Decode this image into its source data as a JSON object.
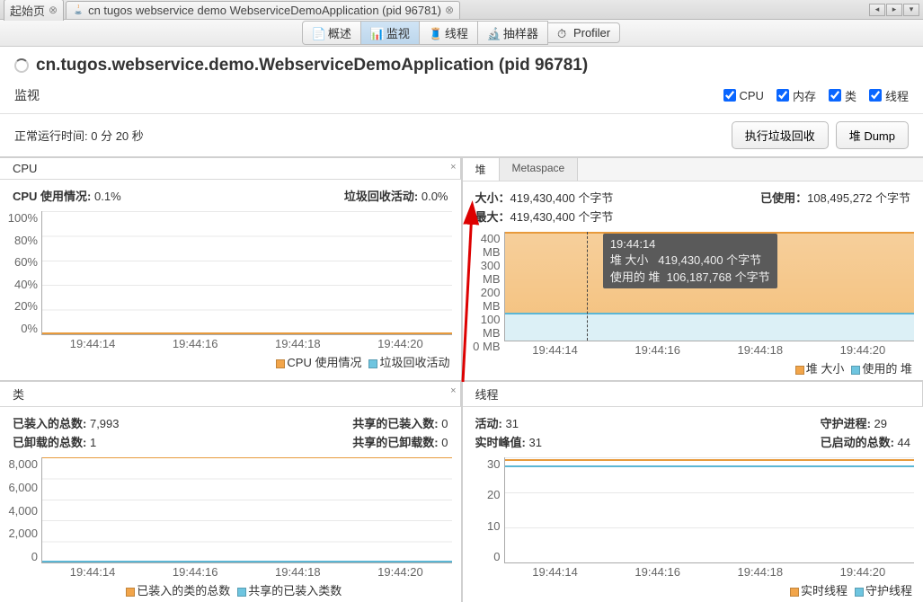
{
  "tabs": {
    "start": "起始页",
    "app": "cn tugos webservice demo WebserviceDemoApplication (pid 96781)"
  },
  "toolbar": {
    "overview": "概述",
    "monitor": "监视",
    "threads": "线程",
    "sampler": "抽样器",
    "profiler": "Profiler"
  },
  "title": "cn.tugos.webservice.demo.WebserviceDemoApplication (pid 96781)",
  "section": "监视",
  "checks": {
    "cpu": "CPU",
    "mem": "内存",
    "class": "类",
    "thread": "线程"
  },
  "uptime": {
    "label": "正常运行时间:",
    "value": "0 分 20 秒"
  },
  "buttons": {
    "gc": "执行垃圾回收",
    "dump": "堆 Dump"
  },
  "cpu": {
    "tab": "CPU",
    "usage_lbl": "CPU 使用情况:",
    "usage_val": "0.1%",
    "gc_lbl": "垃圾回收活动:",
    "gc_val": "0.0%",
    "legend1": "CPU 使用情况",
    "legend2": "垃圾回收活动",
    "yticks": [
      "100%",
      "80%",
      "60%",
      "40%",
      "20%",
      "0%"
    ],
    "xticks": [
      "19:44:14",
      "19:44:16",
      "19:44:18",
      "19:44:20"
    ]
  },
  "heap": {
    "tab1": "堆",
    "tab2": "Metaspace",
    "size_lbl": "大小：",
    "size_val": "419,430,400 个字节",
    "max_lbl": "最大：",
    "max_val": "419,430,400 个字节",
    "used_lbl": "已使用：",
    "used_val": "108,495,272 个字节",
    "legend1": "堆 大小",
    "legend2": "使用的 堆",
    "yticks": [
      "400 MB",
      "300 MB",
      "200 MB",
      "100 MB",
      "0 MB"
    ],
    "xticks": [
      "19:44:14",
      "19:44:16",
      "19:44:18",
      "19:44:20"
    ],
    "tooltip": {
      "time": "19:44:14",
      "l1": "堆 大小",
      "v1": "419,430,400 个字节",
      "l2": "使用的 堆",
      "v2": "106,187,768 个字节"
    }
  },
  "classes": {
    "tab": "类",
    "loaded_lbl": "已装入的总数:",
    "loaded_val": "7,993",
    "unloaded_lbl": "已卸载的总数:",
    "unloaded_val": "1",
    "shared_lbl": "共享的已装入数:",
    "shared_val": "0",
    "sharedun_lbl": "共享的已卸载数:",
    "sharedun_val": "0",
    "legend1": "已装入的类的总数",
    "legend2": "共享的已装入类数",
    "yticks": [
      "8,000",
      "6,000",
      "4,000",
      "2,000",
      "0"
    ],
    "xticks": [
      "19:44:14",
      "19:44:16",
      "19:44:18",
      "19:44:20"
    ]
  },
  "threads": {
    "tab": "线程",
    "live_lbl": "活动:",
    "live_val": "31",
    "peak_lbl": "实时峰值:",
    "peak_val": "31",
    "daemon_lbl": "守护进程:",
    "daemon_val": "29",
    "started_lbl": "已启动的总数:",
    "started_val": "44",
    "legend1": "实时线程",
    "legend2": "守护线程",
    "yticks": [
      "30",
      "20",
      "10",
      "0"
    ],
    "xticks": [
      "19:44:14",
      "19:44:16",
      "19:44:18",
      "19:44:20"
    ]
  },
  "chart_data": [
    {
      "type": "line",
      "title": "CPU",
      "x": [
        "19:44:14",
        "19:44:16",
        "19:44:18",
        "19:44:20"
      ],
      "series": [
        {
          "name": "CPU 使用情况",
          "values": [
            0.1,
            0.1,
            0.1,
            0.1
          ]
        },
        {
          "name": "垃圾回收活动",
          "values": [
            0,
            0,
            0,
            0
          ]
        }
      ],
      "ylim": [
        0,
        100
      ],
      "ylabel": "%"
    },
    {
      "type": "area",
      "title": "堆",
      "x": [
        "19:44:14",
        "19:44:16",
        "19:44:18",
        "19:44:20"
      ],
      "series": [
        {
          "name": "堆 大小",
          "values": [
            419430400,
            419430400,
            419430400,
            419430400
          ]
        },
        {
          "name": "使用的 堆",
          "values": [
            106187768,
            107000000,
            107800000,
            108495272
          ]
        }
      ],
      "ylim": [
        0,
        419430400
      ],
      "ylabel": "bytes"
    },
    {
      "type": "line",
      "title": "类",
      "x": [
        "19:44:14",
        "19:44:16",
        "19:44:18",
        "19:44:20"
      ],
      "series": [
        {
          "name": "已装入的类的总数",
          "values": [
            7993,
            7993,
            7993,
            7993
          ]
        },
        {
          "name": "共享的已装入类数",
          "values": [
            0,
            0,
            0,
            0
          ]
        }
      ],
      "ylim": [
        0,
        8000
      ]
    },
    {
      "type": "line",
      "title": "线程",
      "x": [
        "19:44:14",
        "19:44:16",
        "19:44:18",
        "19:44:20"
      ],
      "series": [
        {
          "name": "实时线程",
          "values": [
            31,
            31,
            31,
            31
          ]
        },
        {
          "name": "守护线程",
          "values": [
            29,
            29,
            29,
            29
          ]
        }
      ],
      "ylim": [
        0,
        32
      ]
    }
  ]
}
